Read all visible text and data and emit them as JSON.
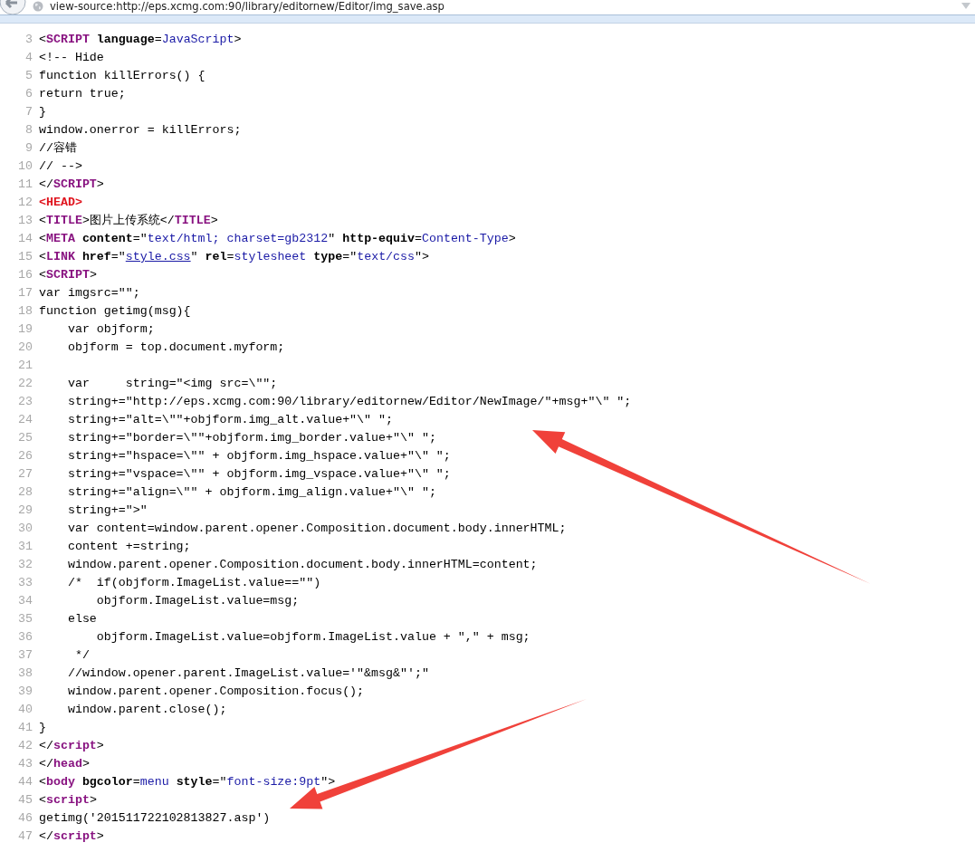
{
  "address_bar": {
    "url": "view-source:http://eps.xcmg.com:90/library/editornew/Editor/img_save.asp"
  },
  "source_lines": [
    {
      "number": "3",
      "segments": [
        {
          "kind": "text",
          "text": "<"
        },
        {
          "kind": "tag",
          "text": "SCRIPT"
        },
        {
          "kind": "attr",
          "text": " language"
        },
        {
          "kind": "text",
          "text": "="
        },
        {
          "kind": "value",
          "text": "JavaScript"
        },
        {
          "kind": "text",
          "text": ">"
        }
      ]
    },
    {
      "number": "4",
      "segments": [
        {
          "kind": "text",
          "text": "<!-- Hide"
        }
      ]
    },
    {
      "number": "5",
      "segments": [
        {
          "kind": "text",
          "text": "function killErrors() {"
        }
      ]
    },
    {
      "number": "6",
      "segments": [
        {
          "kind": "text",
          "text": "return true;"
        }
      ]
    },
    {
      "number": "7",
      "segments": [
        {
          "kind": "text",
          "text": "}"
        }
      ]
    },
    {
      "number": "8",
      "segments": [
        {
          "kind": "text",
          "text": "window.onerror = killErrors;"
        }
      ]
    },
    {
      "number": "9",
      "segments": [
        {
          "kind": "text",
          "text": "//容错"
        }
      ]
    },
    {
      "number": "10",
      "segments": [
        {
          "kind": "text",
          "text": "// -->"
        }
      ]
    },
    {
      "number": "11",
      "segments": [
        {
          "kind": "text",
          "text": "</"
        },
        {
          "kind": "tag",
          "text": "SCRIPT"
        },
        {
          "kind": "text",
          "text": ">"
        }
      ]
    },
    {
      "number": "12",
      "segments": [
        {
          "kind": "doc_tag",
          "text": "<HEAD>"
        }
      ]
    },
    {
      "number": "13",
      "segments": [
        {
          "kind": "text",
          "text": "<"
        },
        {
          "kind": "tag",
          "text": "TITLE"
        },
        {
          "kind": "text",
          "text": ">图片上传系统</"
        },
        {
          "kind": "tag",
          "text": "TITLE"
        },
        {
          "kind": "text",
          "text": ">"
        }
      ]
    },
    {
      "number": "14",
      "segments": [
        {
          "kind": "text",
          "text": "<"
        },
        {
          "kind": "tag",
          "text": "META"
        },
        {
          "kind": "attr",
          "text": " content"
        },
        {
          "kind": "text",
          "text": "=\""
        },
        {
          "kind": "value",
          "text": "text/html; charset=gb2312"
        },
        {
          "kind": "text",
          "text": "\" "
        },
        {
          "kind": "attr",
          "text": "http-equiv"
        },
        {
          "kind": "text",
          "text": "="
        },
        {
          "kind": "value",
          "text": "Content-Type"
        },
        {
          "kind": "text",
          "text": ">"
        }
      ]
    },
    {
      "number": "15",
      "segments": [
        {
          "kind": "text",
          "text": "<"
        },
        {
          "kind": "tag",
          "text": "LINK"
        },
        {
          "kind": "attr",
          "text": " href"
        },
        {
          "kind": "text",
          "text": "=\""
        },
        {
          "kind": "link",
          "text": "style.css"
        },
        {
          "kind": "text",
          "text": "\" "
        },
        {
          "kind": "attr",
          "text": "rel"
        },
        {
          "kind": "text",
          "text": "="
        },
        {
          "kind": "value",
          "text": "stylesheet"
        },
        {
          "kind": "attr",
          "text": " type"
        },
        {
          "kind": "text",
          "text": "=\""
        },
        {
          "kind": "value",
          "text": "text/css"
        },
        {
          "kind": "text",
          "text": "\">"
        }
      ]
    },
    {
      "number": "16",
      "segments": [
        {
          "kind": "text",
          "text": "<"
        },
        {
          "kind": "tag",
          "text": "SCRIPT"
        },
        {
          "kind": "text",
          "text": ">"
        }
      ]
    },
    {
      "number": "17",
      "segments": [
        {
          "kind": "text",
          "text": "var imgsrc=\"\";"
        }
      ]
    },
    {
      "number": "18",
      "segments": [
        {
          "kind": "text",
          "text": "function getimg(msg){"
        }
      ]
    },
    {
      "number": "19",
      "segments": [
        {
          "kind": "text",
          "text": "    var objform;"
        }
      ]
    },
    {
      "number": "20",
      "segments": [
        {
          "kind": "text",
          "text": "    objform = top.document.myform;"
        }
      ]
    },
    {
      "number": "21"
    },
    {
      "number": "22",
      "segments": [
        {
          "kind": "text",
          "text": "    var     string=\"<img src=\\\"\";"
        }
      ]
    },
    {
      "number": "23",
      "segments": [
        {
          "kind": "text",
          "text": "    string+=\"http://eps.xcmg.com:90/library/editornew/Editor/NewImage/\"+msg+\"\\\" \";"
        }
      ]
    },
    {
      "number": "24",
      "segments": [
        {
          "kind": "text",
          "text": "    string+=\"alt=\\\"\"+objform.img_alt.value+\"\\\" \";"
        }
      ]
    },
    {
      "number": "25",
      "segments": [
        {
          "kind": "text",
          "text": "    string+=\"border=\\\"\"+objform.img_border.value+\"\\\" \";"
        }
      ]
    },
    {
      "number": "26",
      "segments": [
        {
          "kind": "text",
          "text": "    string+=\"hspace=\\\"\" + objform.img_hspace.value+\"\\\" \";"
        }
      ]
    },
    {
      "number": "27",
      "segments": [
        {
          "kind": "text",
          "text": "    string+=\"vspace=\\\"\" + objform.img_vspace.value+\"\\\" \";"
        }
      ]
    },
    {
      "number": "28",
      "segments": [
        {
          "kind": "text",
          "text": "    string+=\"align=\\\"\" + objform.img_align.value+\"\\\" \";"
        }
      ]
    },
    {
      "number": "29",
      "segments": [
        {
          "kind": "text",
          "text": "    string+=\">\""
        }
      ]
    },
    {
      "number": "30",
      "segments": [
        {
          "kind": "text",
          "text": "    var content=window.parent.opener.Composition.document.body.innerHTML;"
        }
      ]
    },
    {
      "number": "31",
      "segments": [
        {
          "kind": "text",
          "text": "    content +=string;"
        }
      ]
    },
    {
      "number": "32",
      "segments": [
        {
          "kind": "text",
          "text": "    window.parent.opener.Composition.document.body.innerHTML=content;"
        }
      ]
    },
    {
      "number": "33",
      "segments": [
        {
          "kind": "text",
          "text": "    /*  if(objform.ImageList.value==\"\")"
        }
      ]
    },
    {
      "number": "34",
      "segments": [
        {
          "kind": "text",
          "text": "        objform.ImageList.value=msg;"
        }
      ]
    },
    {
      "number": "35",
      "segments": [
        {
          "kind": "text",
          "text": "    else"
        }
      ]
    },
    {
      "number": "36",
      "segments": [
        {
          "kind": "text",
          "text": "        objform.ImageList.value=objform.ImageList.value + \",\" + msg;"
        }
      ]
    },
    {
      "number": "37",
      "segments": [
        {
          "kind": "text",
          "text": "     */"
        }
      ]
    },
    {
      "number": "38",
      "segments": [
        {
          "kind": "text",
          "text": "    //window.opener.parent.ImageList.value='\"&msg&\"';\""
        }
      ]
    },
    {
      "number": "39",
      "segments": [
        {
          "kind": "text",
          "text": "    window.parent.opener.Composition.focus();"
        }
      ]
    },
    {
      "number": "40",
      "segments": [
        {
          "kind": "text",
          "text": "    window.parent.close();"
        }
      ]
    },
    {
      "number": "41",
      "segments": [
        {
          "kind": "text",
          "text": "}"
        }
      ]
    },
    {
      "number": "42",
      "segments": [
        {
          "kind": "text",
          "text": "</"
        },
        {
          "kind": "tag",
          "text": "script"
        },
        {
          "kind": "text",
          "text": ">"
        }
      ]
    },
    {
      "number": "43",
      "segments": [
        {
          "kind": "text",
          "text": "</"
        },
        {
          "kind": "tag",
          "text": "head"
        },
        {
          "kind": "text",
          "text": ">"
        }
      ]
    },
    {
      "number": "44",
      "segments": [
        {
          "kind": "text",
          "text": "<"
        },
        {
          "kind": "tag",
          "text": "body"
        },
        {
          "kind": "attr",
          "text": " bgcolor"
        },
        {
          "kind": "text",
          "text": "="
        },
        {
          "kind": "value",
          "text": "menu"
        },
        {
          "kind": "attr",
          "text": " style"
        },
        {
          "kind": "text",
          "text": "=\""
        },
        {
          "kind": "value",
          "text": "font-size:9pt"
        },
        {
          "kind": "text",
          "text": "\">"
        }
      ]
    },
    {
      "number": "45",
      "segments": [
        {
          "kind": "text",
          "text": "<"
        },
        {
          "kind": "tag",
          "text": "script"
        },
        {
          "kind": "text",
          "text": ">"
        }
      ]
    },
    {
      "number": "46",
      "segments": [
        {
          "kind": "text",
          "text": "getimg('201511722102813827.asp')"
        }
      ]
    },
    {
      "number": "47",
      "segments": [
        {
          "kind": "text",
          "text": "</"
        },
        {
          "kind": "tag",
          "text": "script"
        },
        {
          "kind": "text",
          "text": ">"
        }
      ]
    }
  ]
}
